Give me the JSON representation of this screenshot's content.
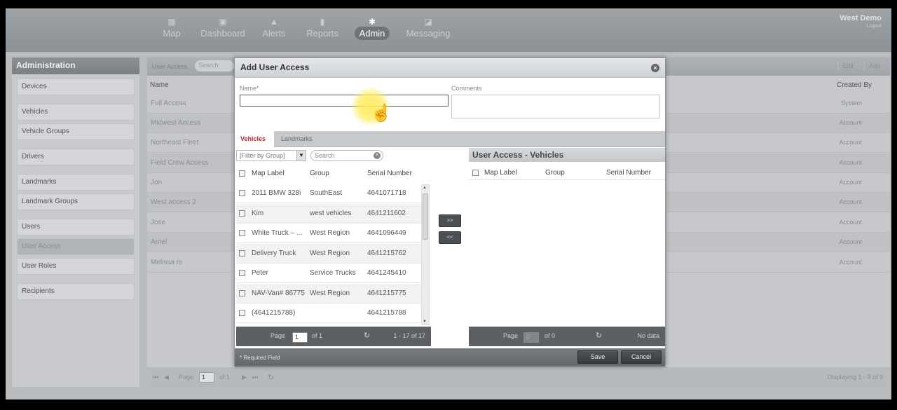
{
  "nav": {
    "items": [
      {
        "icon": "map-icon",
        "label": "Map"
      },
      {
        "icon": "dashboard-icon",
        "label": "Dashboard"
      },
      {
        "icon": "bell-icon",
        "label": "Alerts"
      },
      {
        "icon": "bar-chart-icon",
        "label": "Reports"
      },
      {
        "icon": "gear-icon",
        "label": "Admin"
      },
      {
        "icon": "messaging-icon",
        "label": "Messaging"
      }
    ],
    "active": "Admin",
    "user_name": "West Demo",
    "logout": "Logout"
  },
  "sidebar": {
    "title": "Administration",
    "items": [
      "Devices",
      "Vehicles",
      "Vehicle Groups",
      "Drivers",
      "Landmarks",
      "Landmark Groups",
      "Users",
      "User Access",
      "User Roles",
      "Recipients"
    ],
    "active": "User Access"
  },
  "grid": {
    "title": "User Access",
    "search_placeholder": "Search",
    "edit": "Edit",
    "add": "Add",
    "col_name": "Name",
    "col_created": "Created By",
    "rows": [
      {
        "name": "Full Access",
        "created": "System"
      },
      {
        "name": "Midwest Access",
        "created": "Account"
      },
      {
        "name": "Northeast Fleet",
        "created": "Account"
      },
      {
        "name": "Field Crew Access",
        "created": "Account"
      },
      {
        "name": "Jon",
        "created": "Account"
      },
      {
        "name": "West access 2",
        "created": "Account"
      },
      {
        "name": "Jose",
        "created": "Account"
      },
      {
        "name": "Arnel",
        "created": "Account"
      },
      {
        "name": "Melissa m",
        "created": "Account"
      }
    ],
    "page_label": "Page",
    "page": "1",
    "of": "of 1",
    "displaying": "Displaying 1 - 9 of 9"
  },
  "modal": {
    "title": "Add User Access",
    "name_label": "Name*",
    "comments_label": "Comments",
    "tabs": [
      "Vehicles",
      "Landmarks"
    ],
    "filter_placeholder": "[Filter by Group]",
    "search_placeholder": "Search",
    "cols": [
      "Map Label",
      "Group",
      "Serial Number"
    ],
    "rows": [
      {
        "label": "2011 BMW 328i",
        "group": "SouthEast",
        "serial": "4641071718"
      },
      {
        "label": "Kim",
        "group": "west vehicles",
        "serial": "4641211602"
      },
      {
        "label": "White Truck – ...",
        "group": "West Region",
        "serial": "4641096449"
      },
      {
        "label": "Delivery Truck",
        "group": "West Region",
        "serial": "4641215762"
      },
      {
        "label": "Peter",
        "group": "Service Trucks",
        "serial": "4641245410"
      },
      {
        "label": "NAV-Van# 86775",
        "group": "West Region",
        "serial": "4641215775"
      },
      {
        "label": "(4641215788)",
        "group": "",
        "serial": "4641215788"
      }
    ],
    "move_right": ">>",
    "move_left": "<<",
    "right_title": "User Access - Vehicles",
    "left_pager": {
      "page_label": "Page",
      "page": "1",
      "of": "of 1",
      "range": "1 - 17 of 17"
    },
    "right_pager": {
      "page_label": "Page",
      "page": "0",
      "of": "of 0",
      "range": "No data"
    },
    "required_note": "* Required Field",
    "save": "Save",
    "cancel": "Cancel"
  }
}
